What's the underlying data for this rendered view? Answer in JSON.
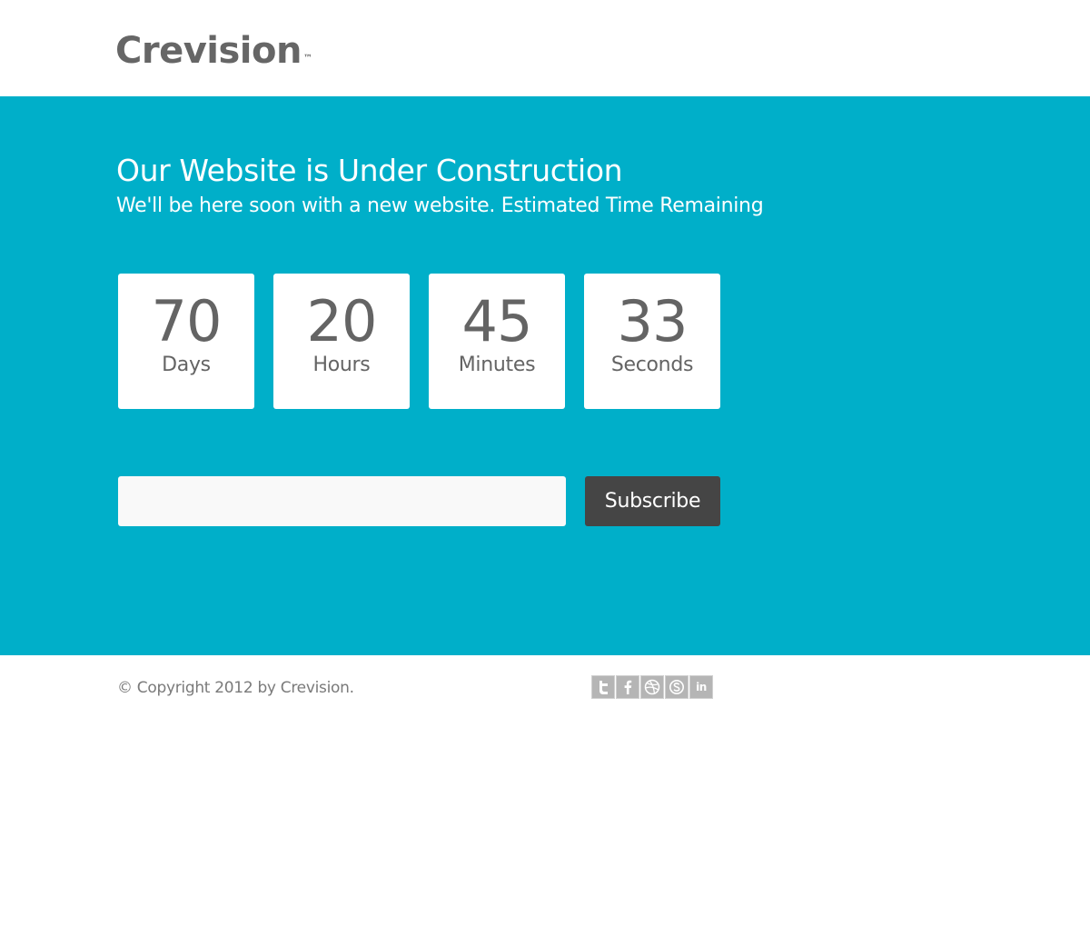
{
  "header": {
    "logo_text": "Crevision",
    "logo_mark": "™"
  },
  "hero": {
    "title": "Our Website is Under Construction",
    "subtitle": "We'll be here soon with a new website. Estimated Time Remaining",
    "background_color": "#00afc9"
  },
  "countdown": [
    {
      "value": "70",
      "unit": "Days"
    },
    {
      "value": "20",
      "unit": "Hours"
    },
    {
      "value": "45",
      "unit": "Minutes"
    },
    {
      "value": "33",
      "unit": "Seconds"
    }
  ],
  "subscribe": {
    "email_value": "",
    "email_placeholder": "",
    "button_label": "Subscribe",
    "button_color": "#454545"
  },
  "footer": {
    "copyright": "© Copyright 2012 by Crevision.",
    "social_icons": [
      {
        "name": "twitter-icon",
        "glyph": "t"
      },
      {
        "name": "facebook-icon",
        "glyph": "f"
      },
      {
        "name": "dribbble-icon",
        "glyph": ""
      },
      {
        "name": "skype-icon",
        "glyph": ""
      },
      {
        "name": "linkedin-icon",
        "glyph": "in"
      }
    ],
    "icon_color": "#b5b5b5"
  }
}
